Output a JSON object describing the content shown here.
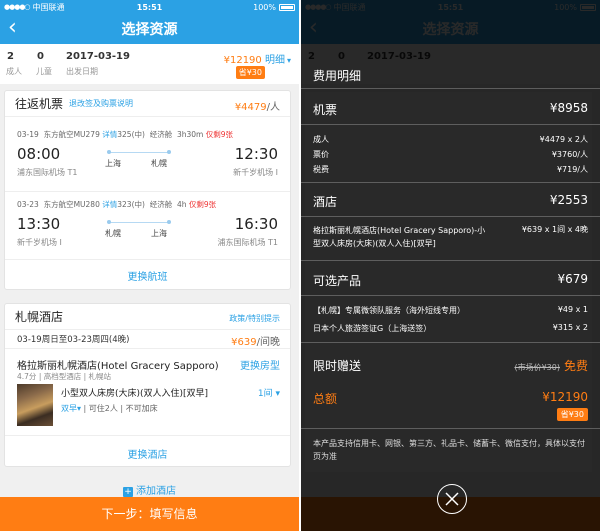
{
  "status_bar": {
    "carrier": "中国联通",
    "time": "15:51",
    "battery": "100%",
    "signal": "●●●●○"
  },
  "nav": {
    "back": "‹",
    "title": "选择资源"
  },
  "summary": {
    "adults": "2",
    "adults_label": "成人",
    "children": "0",
    "children_label": "儿童",
    "date": "2017-03-19",
    "date_label": "出发日期",
    "price": "¥12190",
    "detail_label": "明细",
    "save": "省¥30"
  },
  "flight_card": {
    "title": "往返机票",
    "policy_link": "退改签及购票说明",
    "price": "¥4479",
    "unit": "/人",
    "flights": [
      {
        "date": "03-19",
        "airline": "东方航空MU279",
        "detail": "详情",
        "aircraft": "325(中)",
        "cabin": "经济舱",
        "duration": "3h30m",
        "remaining": "仅剩9张",
        "dep_time": "08:00",
        "arr_time": "12:30",
        "dep_city": "上海",
        "arr_city": "札幌",
        "dep_airport": "浦东国际机场 T1",
        "arr_airport": "新千岁机场 I"
      },
      {
        "date": "03-23",
        "airline": "东方航空MU280",
        "detail": "详情",
        "aircraft": "323(中)",
        "cabin": "经济舱",
        "duration": "4h",
        "remaining": "仅剩9张",
        "dep_time": "13:30",
        "arr_time": "16:30",
        "dep_city": "札幌",
        "arr_city": "上海",
        "dep_airport": "新千岁机场 I",
        "arr_airport": "浦东国际机场 T1"
      }
    ],
    "change_label": "更换航班"
  },
  "hotel_card": {
    "title": "札幌酒店",
    "policy_link": "政策/特别提示",
    "dates": "03-19周日至03-23周四(4晚)",
    "price": "¥639",
    "unit": "/间晚",
    "name": "格拉斯丽札幌酒店(Hotel Gracery Sapporo)",
    "change_room": "更换房型",
    "rating": "4.7分",
    "type": "高档型酒店",
    "district": "札幌站",
    "room": "小型双人床房(大床)(双人入住)[双早]",
    "rooms": "1间",
    "breakfast": "双早",
    "occupancy": "可住2人",
    "addbed": "不可加床",
    "change_label": "更换酒店"
  },
  "add_hotel": "添加酒店",
  "next_button": "下一步：填写信息",
  "fee_sheet": {
    "title": "费用明细",
    "flight": {
      "label": "机票",
      "total": "¥8958",
      "rows": [
        {
          "label": "成人",
          "value": "¥4479 x 2人"
        },
        {
          "label": "票价",
          "value": "¥3760/人"
        },
        {
          "label": "税费",
          "value": "¥719/人"
        }
      ]
    },
    "hotel": {
      "label": "酒店",
      "total": "¥2553",
      "rows": [
        {
          "label": "格拉斯丽札幌酒店(Hotel Gracery Sapporo)-小型双人床房(大床)(双人入住)[双早]",
          "value": "¥639 x 1间 x 4晚"
        }
      ]
    },
    "optional": {
      "label": "可选产品",
      "total": "¥679",
      "rows": [
        {
          "label": "【札幌】专属微领队服务（海外短线专用）",
          "value": "¥49 x 1"
        },
        {
          "label": "日本个人旅游签证G（上海送签）",
          "value": "¥315 x 2"
        }
      ]
    },
    "gift": {
      "label": "限时赠送",
      "original": "(市场价¥30)",
      "free": "免费"
    },
    "total": {
      "label": "总额",
      "value": "¥12190",
      "save": "省¥30"
    },
    "notice": "本产品支持信用卡、网银、第三方、礼品卡、储蓄卡、微信支付，具体以支付页为准",
    "close": "×"
  }
}
